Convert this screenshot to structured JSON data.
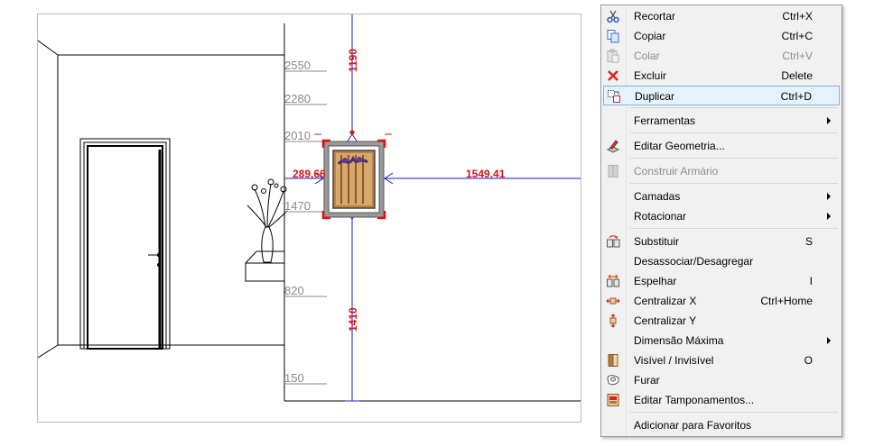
{
  "drawing": {
    "heights": [
      "2550",
      "2280",
      "2010",
      "1470",
      "820",
      "150"
    ],
    "dim_top": "1190",
    "dim_bottom": "1410",
    "dim_left": "289,66",
    "dim_right": "1549,41"
  },
  "menu": {
    "items": [
      {
        "id": "recortar",
        "label": "Recortar",
        "shortcut": "Ctrl+X",
        "icon": "scissors-icon",
        "disabled": false,
        "submenu": false
      },
      {
        "id": "copiar",
        "label": "Copiar",
        "shortcut": "Ctrl+C",
        "icon": "copy-icon",
        "disabled": false,
        "submenu": false
      },
      {
        "id": "colar",
        "label": "Colar",
        "shortcut": "Ctrl+V",
        "icon": "paste-icon",
        "disabled": true,
        "submenu": false
      },
      {
        "id": "excluir",
        "label": "Excluir",
        "shortcut": "Delete",
        "icon": "delete-icon",
        "disabled": false,
        "submenu": false
      },
      {
        "id": "duplicar",
        "label": "Duplicar",
        "shortcut": "Ctrl+D",
        "icon": "duplicate-icon",
        "disabled": false,
        "submenu": false,
        "highlighted": true
      },
      {
        "id": "ferramentas",
        "label": "Ferramentas",
        "shortcut": "",
        "icon": "",
        "disabled": false,
        "submenu": true
      },
      {
        "id": "editar-geometria",
        "label": "Editar Geometria...",
        "shortcut": "",
        "icon": "edit-geometry-icon",
        "disabled": false,
        "submenu": false
      },
      {
        "id": "construir-armario",
        "label": "Construir Armário",
        "shortcut": "",
        "icon": "cabinet-icon",
        "disabled": true,
        "submenu": false
      },
      {
        "id": "camadas",
        "label": "Camadas",
        "shortcut": "",
        "icon": "",
        "disabled": false,
        "submenu": true
      },
      {
        "id": "rotacionar",
        "label": "Rotacionar",
        "shortcut": "",
        "icon": "",
        "disabled": false,
        "submenu": true
      },
      {
        "id": "substituir",
        "label": "Substituir",
        "shortcut": "S",
        "icon": "replace-icon",
        "disabled": false,
        "submenu": false
      },
      {
        "id": "desassociar",
        "label": "Desassociar/Desagregar",
        "shortcut": "",
        "icon": "",
        "disabled": false,
        "submenu": false
      },
      {
        "id": "espelhar",
        "label": "Espelhar",
        "shortcut": "I",
        "icon": "mirror-icon",
        "disabled": false,
        "submenu": false
      },
      {
        "id": "centralizar-x",
        "label": "Centralizar X",
        "shortcut": "Ctrl+Home",
        "icon": "center-x-icon",
        "disabled": false,
        "submenu": false
      },
      {
        "id": "centralizar-y",
        "label": "Centralizar Y",
        "shortcut": "",
        "icon": "center-y-icon",
        "disabled": false,
        "submenu": false
      },
      {
        "id": "dimensao-maxima",
        "label": "Dimensão Máxima",
        "shortcut": "",
        "icon": "",
        "disabled": false,
        "submenu": true
      },
      {
        "id": "visivel",
        "label": "Visível / Invisível",
        "shortcut": "O",
        "icon": "visibility-icon",
        "disabled": false,
        "submenu": false
      },
      {
        "id": "furar",
        "label": "Furar",
        "shortcut": "",
        "icon": "drill-icon",
        "disabled": false,
        "submenu": false
      },
      {
        "id": "editar-tamponamentos",
        "label": "Editar Tamponamentos...",
        "shortcut": "",
        "icon": "panels-icon",
        "disabled": false,
        "submenu": false
      },
      {
        "id": "favoritos",
        "label": "Adicionar para Favoritos",
        "shortcut": "",
        "icon": "",
        "disabled": false,
        "submenu": false
      }
    ]
  },
  "colors": {
    "dimension_line": "#1a1ad6",
    "dimension_text": "#d81313",
    "height_text": "#8a8a8a",
    "highlight_fill": "#e5f1fb",
    "highlight_border": "#7eb4ea"
  }
}
